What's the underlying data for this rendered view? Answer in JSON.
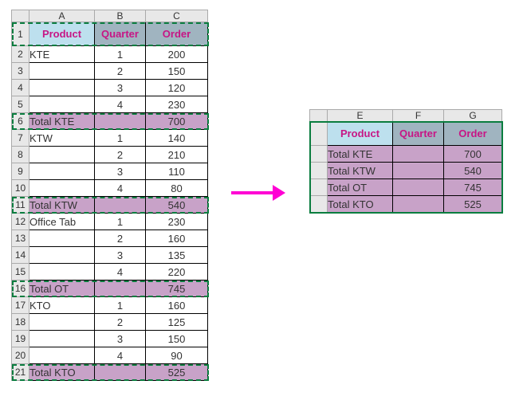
{
  "left": {
    "cols": [
      "A",
      "B",
      "C"
    ],
    "headers": {
      "product": "Product",
      "quarter": "Quarter",
      "order": "Order"
    },
    "rows": [
      {
        "n": 1,
        "type": "header"
      },
      {
        "n": 2,
        "a": "KTE",
        "b": "1",
        "c": "200"
      },
      {
        "n": 3,
        "a": "",
        "b": "2",
        "c": "150"
      },
      {
        "n": 4,
        "a": "",
        "b": "3",
        "c": "120"
      },
      {
        "n": 5,
        "a": "",
        "b": "4",
        "c": "230"
      },
      {
        "n": 6,
        "type": "total",
        "a": "Total KTE",
        "b": "",
        "c": "700"
      },
      {
        "n": 7,
        "a": "KTW",
        "b": "1",
        "c": "140"
      },
      {
        "n": 8,
        "a": "",
        "b": "2",
        "c": "210"
      },
      {
        "n": 9,
        "a": "",
        "b": "3",
        "c": "110"
      },
      {
        "n": 10,
        "a": "",
        "b": "4",
        "c": "80"
      },
      {
        "n": 11,
        "type": "total",
        "a": "Total KTW",
        "b": "",
        "c": "540"
      },
      {
        "n": 12,
        "a": "Office Tab",
        "b": "1",
        "c": "230"
      },
      {
        "n": 13,
        "a": "",
        "b": "2",
        "c": "160"
      },
      {
        "n": 14,
        "a": "",
        "b": "3",
        "c": "135"
      },
      {
        "n": 15,
        "a": "",
        "b": "4",
        "c": "220"
      },
      {
        "n": 16,
        "type": "total",
        "a": "Total OT",
        "b": "",
        "c": "745"
      },
      {
        "n": 17,
        "a": "KTO",
        "b": "1",
        "c": "160"
      },
      {
        "n": 18,
        "a": "",
        "b": "2",
        "c": "125"
      },
      {
        "n": 19,
        "a": "",
        "b": "3",
        "c": "150"
      },
      {
        "n": 20,
        "a": "",
        "b": "4",
        "c": "90"
      },
      {
        "n": 21,
        "type": "total",
        "a": "Total KTO",
        "b": "",
        "c": "525"
      }
    ]
  },
  "right": {
    "cols": [
      "E",
      "F",
      "G"
    ],
    "headers": {
      "product": "Product",
      "quarter": "Quarter",
      "order": "Order"
    },
    "rows": [
      {
        "a": "Total KTE",
        "b": "",
        "c": "700"
      },
      {
        "a": "Total KTW",
        "b": "",
        "c": "540"
      },
      {
        "a": "Total OT",
        "b": "",
        "c": "745"
      },
      {
        "a": "Total KTO",
        "b": "",
        "c": "525"
      }
    ]
  }
}
